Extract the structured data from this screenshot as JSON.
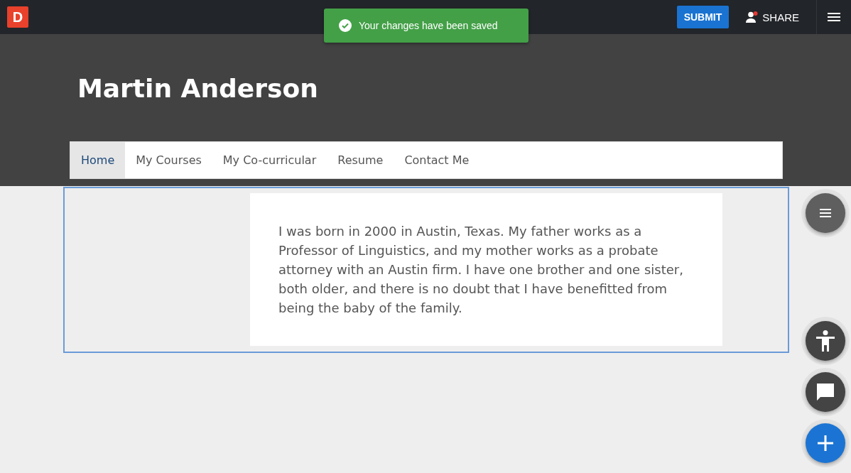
{
  "topbar": {
    "logo": "D",
    "submit": "SUBMIT",
    "share": "SHARE",
    "share_notification": true
  },
  "toast": {
    "message": "Your changes have been saved"
  },
  "banner": {
    "title": "Martin Anderson"
  },
  "nav": [
    {
      "label": "Home",
      "selected": true
    },
    {
      "label": "My Courses",
      "selected": false
    },
    {
      "label": "My Co-curricular",
      "selected": false
    },
    {
      "label": "Resume",
      "selected": false
    },
    {
      "label": "Contact Me",
      "selected": false
    }
  ],
  "content": {
    "block_selected": true,
    "text": "I was born in 2000 in Austin, Texas. My father works as a Professor of Linguistics, and my mother works as a probate attorney with an Austin firm. I have one brother and one sister, both older, and there is no doubt that I have benefitted from being the baby of the family."
  },
  "fabs": [
    {
      "kind": "menu"
    },
    {
      "kind": "accessibility"
    },
    {
      "kind": "chat"
    },
    {
      "kind": "add"
    }
  ]
}
